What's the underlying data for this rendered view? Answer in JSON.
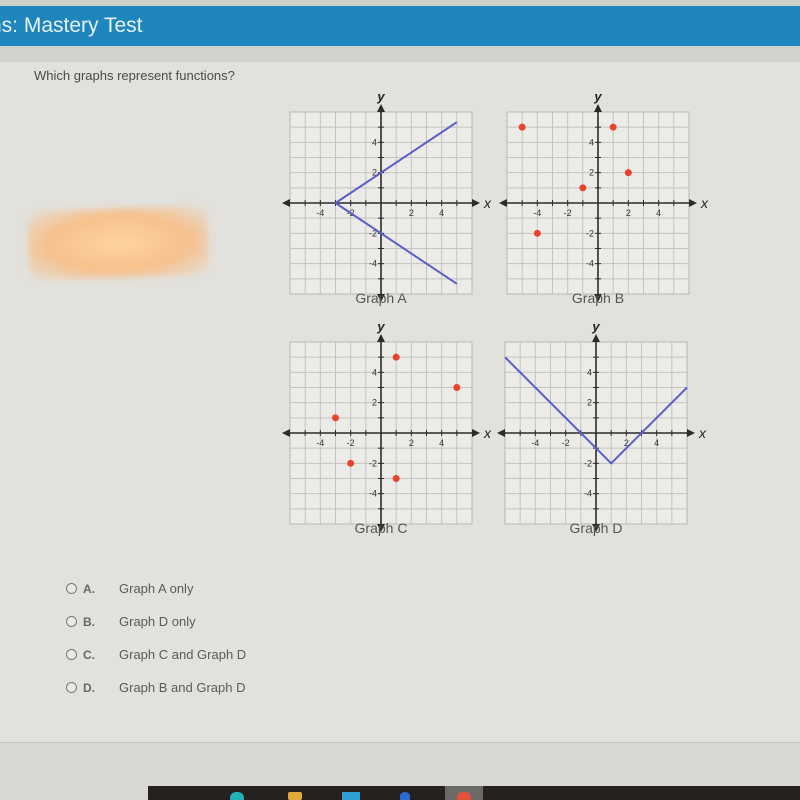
{
  "header": {
    "title": "ns: Mastery Test"
  },
  "question": {
    "text": "Which graphs represent functions?"
  },
  "colors": {
    "header_bg": "#1f86bd",
    "line": "#5a5fc8",
    "point": "#e8432d"
  },
  "options": [
    {
      "letter": "A.",
      "label": "Graph A only"
    },
    {
      "letter": "B.",
      "label": "Graph D only"
    },
    {
      "letter": "C.",
      "label": "Graph C and Graph D"
    },
    {
      "letter": "D.",
      "label": "Graph B and Graph D"
    }
  ],
  "taskbar": {
    "icons": [
      "teal-app-icon",
      "folder-icon",
      "store-icon",
      "blue-app-icon",
      "red-app-icon"
    ]
  },
  "chart_data": [
    {
      "type": "line",
      "title": "Graph A",
      "xlabel": "x",
      "ylabel": "y",
      "xlim": [
        -6,
        6
      ],
      "ylim": [
        -6,
        6
      ],
      "xticks": [
        -4,
        -2,
        2,
        4
      ],
      "yticks": [
        4,
        2,
        -2,
        -4
      ],
      "grid": true,
      "series": [
        {
          "name": "upper branch",
          "points": [
            [
              -3,
              0
            ],
            [
              5,
              5.33
            ]
          ]
        },
        {
          "name": "lower branch",
          "points": [
            [
              -3,
              0
            ],
            [
              5,
              -5.33
            ]
          ]
        }
      ]
    },
    {
      "type": "scatter",
      "title": "Graph B",
      "xlabel": "x",
      "ylabel": "y",
      "xlim": [
        -6,
        6
      ],
      "ylim": [
        -6,
        6
      ],
      "xticks": [
        -4,
        -2,
        2,
        4
      ],
      "yticks": [
        4,
        2,
        -2,
        -4
      ],
      "grid": true,
      "points": [
        [
          -5,
          5
        ],
        [
          1,
          5
        ],
        [
          2,
          2
        ],
        [
          -1,
          1
        ],
        [
          -4,
          -2
        ]
      ]
    },
    {
      "type": "scatter",
      "title": "Graph C",
      "xlabel": "x",
      "ylabel": "y",
      "xlim": [
        -6,
        6
      ],
      "ylim": [
        -6,
        6
      ],
      "xticks": [
        -4,
        -2,
        2,
        4
      ],
      "yticks": [
        4,
        2,
        -2,
        -4
      ],
      "grid": true,
      "points": [
        [
          1,
          5
        ],
        [
          5,
          3
        ],
        [
          -3,
          1
        ],
        [
          -2,
          -2
        ],
        [
          1,
          -3
        ]
      ]
    },
    {
      "type": "line",
      "title": "Graph D",
      "xlabel": "x",
      "ylabel": "y",
      "xlim": [
        -6,
        6
      ],
      "ylim": [
        -6,
        6
      ],
      "xticks": [
        -4,
        -2,
        2,
        4
      ],
      "yticks": [
        4,
        2,
        -2,
        -4
      ],
      "grid": true,
      "series": [
        {
          "name": "v-shape",
          "points": [
            [
              -6,
              5
            ],
            [
              1,
              -2
            ],
            [
              6,
              3
            ]
          ]
        }
      ]
    }
  ]
}
